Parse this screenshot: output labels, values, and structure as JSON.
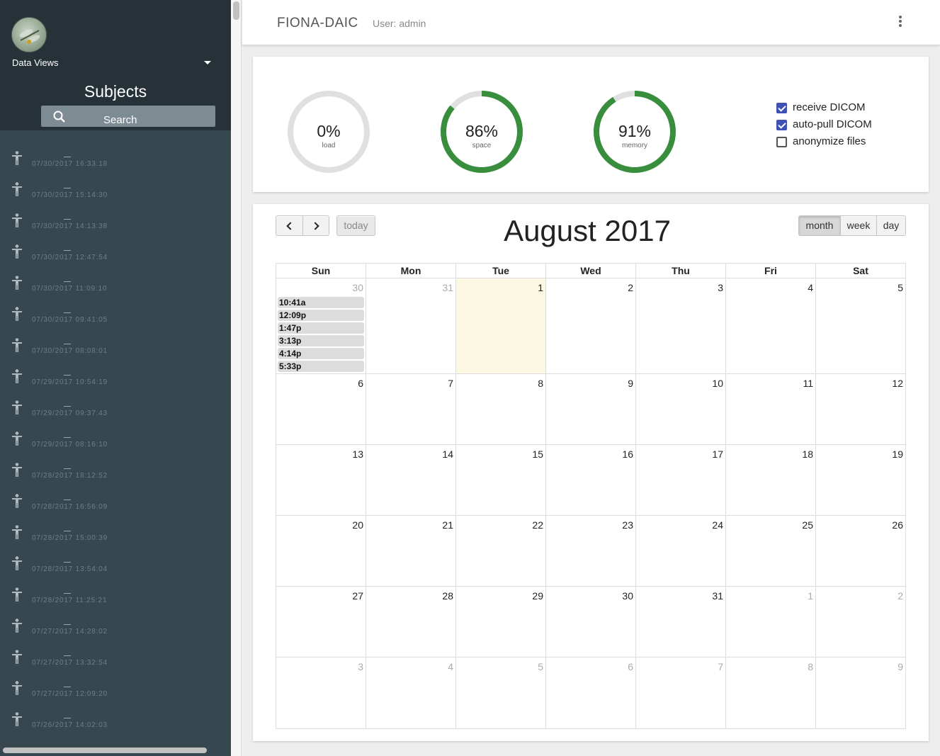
{
  "sidebar": {
    "data_views_label": "Data Views",
    "title": "Subjects",
    "search_label": "Search",
    "subjects": [
      {
        "date": "07/30/2017 16:33:18"
      },
      {
        "date": "07/30/2017 15:14:30"
      },
      {
        "date": "07/30/2017 14:13:38"
      },
      {
        "date": "07/30/2017 12:47:54"
      },
      {
        "date": "07/30/2017 11:09:10"
      },
      {
        "date": "07/30/2017 09:41:05"
      },
      {
        "date": "07/30/2017 08:08:01"
      },
      {
        "date": "07/29/2017 10:54:19"
      },
      {
        "date": "07/29/2017 09:37:43"
      },
      {
        "date": "07/29/2017 08:16:10"
      },
      {
        "date": "07/28/2017 18:12:52"
      },
      {
        "date": "07/28/2017 16:56:09"
      },
      {
        "date": "07/28/2017 15:00:39"
      },
      {
        "date": "07/28/2017 13:54:04"
      },
      {
        "date": "07/28/2017 11:25:21"
      },
      {
        "date": "07/27/2017 14:28:02"
      },
      {
        "date": "07/27/2017 13:32:54"
      },
      {
        "date": "07/27/2017 12:09:20"
      },
      {
        "date": "07/26/2017 14:02:03"
      }
    ]
  },
  "header": {
    "app_title": "FIONA-DAIC",
    "user_label": "User: admin",
    "menu_icon": "more-vert-icon"
  },
  "stats": {
    "gauges": [
      {
        "value_text": "0%",
        "label": "load",
        "fraction": 0.0
      },
      {
        "value_text": "86%",
        "label": "space",
        "fraction": 0.86
      },
      {
        "value_text": "91%",
        "label": "memory",
        "fraction": 0.91
      }
    ],
    "gauge_color": "#388e3c",
    "track_color": "#e0e0e0",
    "options": [
      {
        "label": "receive DICOM",
        "checked": true
      },
      {
        "label": "auto-pull DICOM",
        "checked": true
      },
      {
        "label": "anonymize files",
        "checked": false
      }
    ]
  },
  "calendar": {
    "title": "August 2017",
    "today_label": "today",
    "views": [
      "month",
      "week",
      "day"
    ],
    "active_view": "month",
    "weekdays": [
      "Sun",
      "Mon",
      "Tue",
      "Wed",
      "Thu",
      "Fri",
      "Sat"
    ],
    "weeks": [
      [
        {
          "n": "30",
          "other": true
        },
        {
          "n": "31",
          "other": true
        },
        {
          "n": "1",
          "today": true
        },
        {
          "n": "2"
        },
        {
          "n": "3"
        },
        {
          "n": "4"
        },
        {
          "n": "5"
        }
      ],
      [
        {
          "n": "6"
        },
        {
          "n": "7"
        },
        {
          "n": "8"
        },
        {
          "n": "9"
        },
        {
          "n": "10"
        },
        {
          "n": "11"
        },
        {
          "n": "12"
        }
      ],
      [
        {
          "n": "13"
        },
        {
          "n": "14"
        },
        {
          "n": "15"
        },
        {
          "n": "16"
        },
        {
          "n": "17"
        },
        {
          "n": "18"
        },
        {
          "n": "19"
        }
      ],
      [
        {
          "n": "20"
        },
        {
          "n": "21"
        },
        {
          "n": "22"
        },
        {
          "n": "23"
        },
        {
          "n": "24"
        },
        {
          "n": "25"
        },
        {
          "n": "26"
        }
      ],
      [
        {
          "n": "27"
        },
        {
          "n": "28"
        },
        {
          "n": "29"
        },
        {
          "n": "30"
        },
        {
          "n": "31"
        },
        {
          "n": "1",
          "other": true
        },
        {
          "n": "2",
          "other": true
        }
      ],
      [
        {
          "n": "3",
          "other": true
        },
        {
          "n": "4",
          "other": true
        },
        {
          "n": "5",
          "other": true
        },
        {
          "n": "6",
          "other": true
        },
        {
          "n": "7",
          "other": true
        },
        {
          "n": "8",
          "other": true
        },
        {
          "n": "9",
          "other": true
        }
      ]
    ],
    "events_jul30": [
      "10:41a",
      "12:09p",
      "1:47p",
      "3:13p",
      "4:14p",
      "5:33p"
    ]
  }
}
